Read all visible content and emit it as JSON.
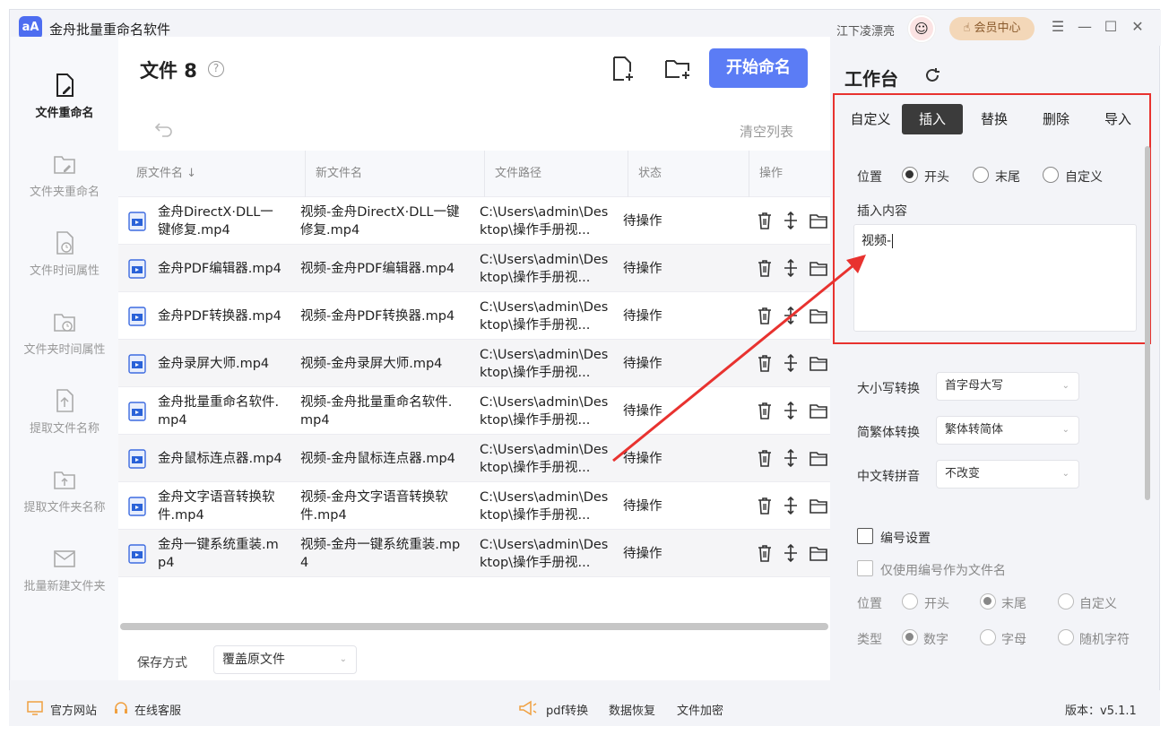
{
  "app": {
    "title": "金舟批量重命名软件",
    "logo_text": "aA",
    "username": "江下凌漂亮",
    "vip_label": "会员中心",
    "window_controls": [
      "menu-icon",
      "minimize-icon",
      "maximize-icon",
      "close-icon"
    ]
  },
  "sidebar": {
    "items": [
      {
        "label": "文件重命名",
        "icon": "file-rename-icon",
        "active": true
      },
      {
        "label": "文件夹重命名",
        "icon": "folder-rename-icon",
        "active": false
      },
      {
        "label": "文件时间属性",
        "icon": "file-time-icon",
        "active": false
      },
      {
        "label": "文件夹时间属性",
        "icon": "folder-time-icon",
        "active": false
      },
      {
        "label": "提取文件名称",
        "icon": "extract-file-icon",
        "active": false
      },
      {
        "label": "提取文件夹名称",
        "icon": "extract-folder-icon",
        "active": false
      },
      {
        "label": "批量新建文件夹",
        "icon": "new-folder-icon",
        "active": false
      }
    ]
  },
  "main": {
    "title": "文件 8",
    "start_button": "开始命名",
    "clear_list": "清空列表",
    "columns": [
      "原文件名 ↓",
      "新文件名",
      "文件路径",
      "状态",
      "操作"
    ],
    "rows": [
      {
        "original": "金舟DirectX·DLL一键修复.mp4",
        "new": "视频-金舟DirectX·DLL一键修复.mp4",
        "path": "C:\\Users\\admin\\Desktop\\操作手册视...",
        "status": "待操作"
      },
      {
        "original": "金舟PDF编辑器.mp4",
        "new": "视频-金舟PDF编辑器.mp4",
        "path": "C:\\Users\\admin\\Desktop\\操作手册视...",
        "status": "待操作"
      },
      {
        "original": "金舟PDF转换器.mp4",
        "new": "视频-金舟PDF转换器.mp4",
        "path": "C:\\Users\\admin\\Desktop\\操作手册视...",
        "status": "待操作"
      },
      {
        "original": "金舟录屏大师.mp4",
        "new": "视频-金舟录屏大师.mp4",
        "path": "C:\\Users\\admin\\Desktop\\操作手册视...",
        "status": "待操作"
      },
      {
        "original": "金舟批量重命名软件.mp4",
        "new": "视频-金舟批量重命名软件.mp4",
        "path": "C:\\Users\\admin\\Desktop\\操作手册视...",
        "status": "待操作"
      },
      {
        "original": "金舟鼠标连点器.mp4",
        "new": "视频-金舟鼠标连点器.mp4",
        "path": "C:\\Users\\admin\\Desktop\\操作手册视...",
        "status": "待操作"
      },
      {
        "original": "金舟文字语音转换软件.mp4",
        "new": "视频-金舟文字语音转换软件.mp4",
        "path": "C:\\Users\\admin\\Desktop\\操作手册视...",
        "status": "待操作"
      },
      {
        "original": "金舟一键系统重装.mp4",
        "new": "视频-金舟一键系统重装.mp4",
        "path": "C:\\Users\\admin\\Desktop\\操作手册视...",
        "status": "待操作"
      }
    ],
    "save_label": "保存方式",
    "save_value": "覆盖原文件"
  },
  "workspace": {
    "title": "工作台",
    "tabs": [
      "自定义",
      "插入",
      "替换",
      "删除",
      "导入"
    ],
    "active_tab": "插入",
    "position_label": "位置",
    "position_options": [
      "开头",
      "末尾",
      "自定义"
    ],
    "insert_label": "插入内容",
    "insert_value": "视频-",
    "case_label": "大小写转换",
    "case_value": "首字母大写",
    "trad_label": "简繁体转换",
    "trad_value": "繁体转简体",
    "pinyin_label": "中文转拼音",
    "pinyin_value": "不改变",
    "numbering_label": "编号设置",
    "only_number_label": "仅使用编号作为文件名",
    "num_position_label": "位置",
    "num_position_options": [
      "开头",
      "末尾",
      "自定义"
    ],
    "type_label": "类型",
    "type_options": [
      "数字",
      "字母",
      "随机字符"
    ]
  },
  "footer": {
    "official_site": "官方网站",
    "online_service": "在线客服",
    "pdf": "pdf转换",
    "recovery": "数据恢复",
    "encrypt": "文件加密",
    "version": "版本：v5.1.1"
  },
  "colors": {
    "accent": "#5b7cf5",
    "highlight_box": "#e8322f",
    "tab_active": "#3b3b3b"
  }
}
